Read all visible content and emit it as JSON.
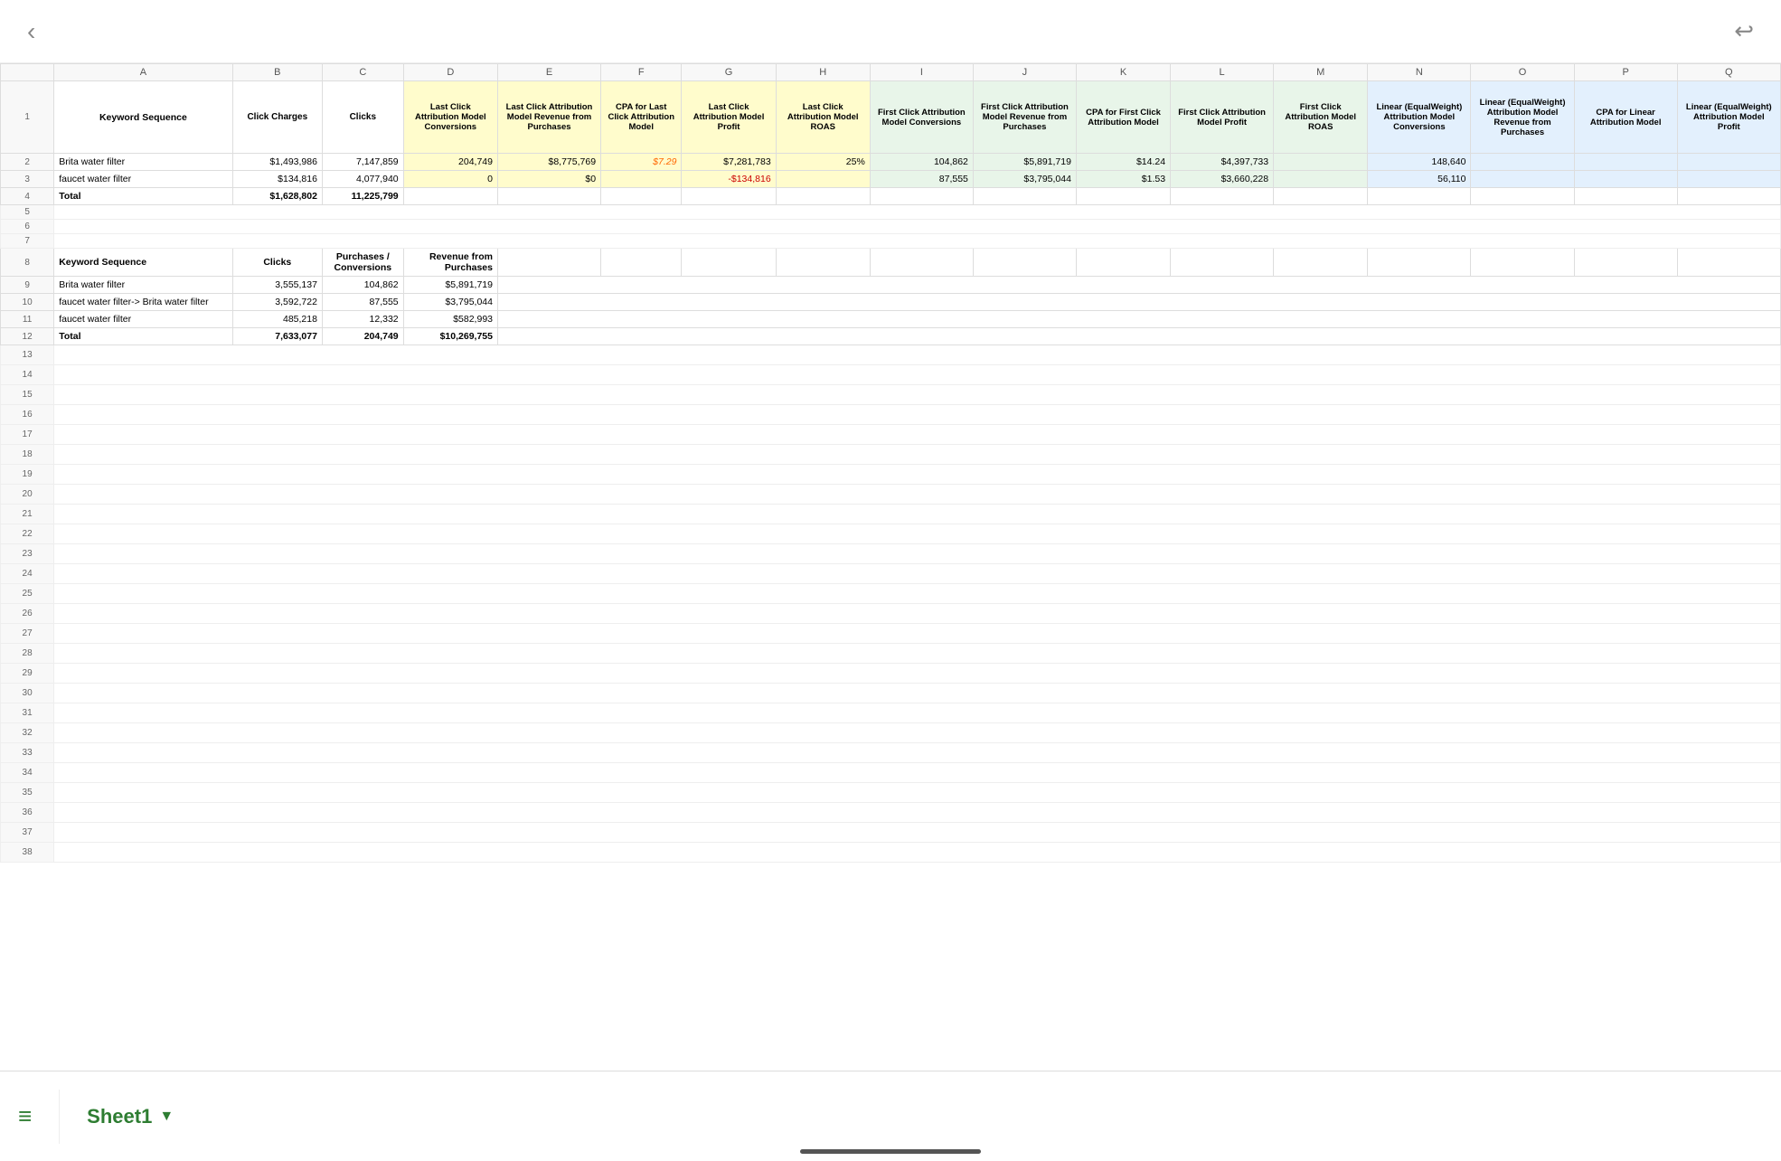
{
  "topBar": {
    "backLabel": "‹",
    "undoLabel": "↩"
  },
  "columns": {
    "letters": [
      "A",
      "B",
      "C",
      "D",
      "E",
      "F",
      "G",
      "H",
      "I",
      "J",
      "K",
      "L",
      "M",
      "N",
      "O",
      "P",
      "Q"
    ]
  },
  "headerRow": {
    "A": "Keyword Sequence",
    "B": "Click Charges",
    "C": "Clicks",
    "D": "Last Click Attribution Model Conversions",
    "E": "Last Click Attribution Model Revenue from Purchases",
    "F": "CPA for Last Click Attribution Model",
    "G": "Last Click Attribution Model Profit",
    "H": "Last Click Attribution Model ROAS",
    "I": "First Click Attribution Model Conversions",
    "J": "First Click Attribution Model Revenue from Purchases",
    "K": "CPA for First Click Attribution Model",
    "L": "First Click Attribution Model Profit",
    "M": "First Click Attribution Model ROAS",
    "N": "Linear (EqualWeight) Attribution Model Conversions",
    "O": "Linear (EqualWeight) Attribution Model Revenue from Purchases",
    "P": "CPA for Linear Attribution Model",
    "Q": "Linear (EqualWeight) Attribution Model Profit"
  },
  "dataRows": [
    {
      "rowNum": 2,
      "A": "Brita water filter",
      "B": "$1,493,986",
      "C": "7,147,859",
      "D": "204,749",
      "E": "$8,775,769",
      "F": "$7.29",
      "G": "$7,281,783",
      "H": "25%",
      "I": "104,862",
      "J": "$5,891,719",
      "K": "$14.24",
      "L": "$4,397,733",
      "M": "",
      "N": "148,640",
      "O": "",
      "P": "",
      "Q": ""
    },
    {
      "rowNum": 3,
      "A": "faucet water filter",
      "B": "$134,816",
      "C": "4,077,940",
      "D": "0",
      "E": "$0",
      "F": "",
      "G": "-$134,816",
      "H": "",
      "I": "87,555",
      "J": "$3,795,044",
      "K": "$1.53",
      "L": "$3,660,228",
      "M": "",
      "N": "56,110",
      "O": "",
      "P": "",
      "Q": ""
    },
    {
      "rowNum": 4,
      "A": "Total",
      "B": "$1,628,802",
      "C": "11,225,799",
      "D": "",
      "E": "",
      "F": "",
      "G": "",
      "H": "",
      "I": "",
      "J": "",
      "K": "",
      "L": "",
      "M": "",
      "N": "",
      "O": "",
      "P": "",
      "Q": ""
    },
    {
      "rowNum": 5,
      "A": "",
      "B": "",
      "C": "",
      "D": "",
      "E": "",
      "F": "",
      "G": "",
      "H": "",
      "I": "",
      "J": "",
      "K": "",
      "L": "",
      "M": "",
      "N": "",
      "O": "",
      "P": "",
      "Q": ""
    },
    {
      "rowNum": 6,
      "A": "",
      "B": "",
      "C": "",
      "D": "",
      "E": "",
      "F": "",
      "G": "",
      "H": "",
      "I": "",
      "J": "",
      "K": "",
      "L": "",
      "M": "",
      "N": "",
      "O": "",
      "P": "",
      "Q": ""
    },
    {
      "rowNum": 7,
      "A": "",
      "B": "",
      "C": "",
      "D": "",
      "E": "",
      "F": "",
      "G": "",
      "H": "",
      "I": "",
      "J": "",
      "K": "",
      "L": "",
      "M": "",
      "N": "",
      "O": "",
      "P": "",
      "Q": ""
    }
  ],
  "secondHeaderRow": {
    "rowNum": 8,
    "A": "Keyword Sequence",
    "B": "Clicks",
    "C": "Purchases / Conversions",
    "D": "Revenue from Purchases",
    "E": "",
    "F": "",
    "G": "",
    "H": "",
    "I": "",
    "J": "",
    "K": "",
    "L": "",
    "M": "",
    "N": "",
    "O": "",
    "P": "",
    "Q": ""
  },
  "secondDataRows": [
    {
      "rowNum": 9,
      "A": "Brita water filter",
      "B": "3,555,137",
      "C": "104,862",
      "D": "$5,891,719",
      "E": "",
      "F": "",
      "G": "",
      "H": "",
      "I": "",
      "J": "",
      "K": "",
      "L": "",
      "M": "",
      "N": "",
      "O": "",
      "P": "",
      "Q": ""
    },
    {
      "rowNum": 10,
      "A": "faucet water filter-> Brita water filter",
      "B": "3,592,722",
      "C": "87,555",
      "D": "$3,795,044",
      "E": "",
      "F": "",
      "G": "",
      "H": "",
      "I": "",
      "J": "",
      "K": "",
      "L": "",
      "M": "",
      "N": "",
      "O": "",
      "P": "",
      "Q": ""
    },
    {
      "rowNum": 11,
      "A": "faucet water filter",
      "B": "485,218",
      "C": "12,332",
      "D": "$582,993",
      "E": "",
      "F": "",
      "G": "",
      "H": "",
      "I": "",
      "J": "",
      "K": "",
      "L": "",
      "M": "",
      "N": "",
      "O": "",
      "P": "",
      "Q": ""
    },
    {
      "rowNum": 12,
      "A": "Total",
      "B": "7,633,077",
      "C": "204,749",
      "D": "$10,269,755",
      "E": "",
      "F": "",
      "G": "",
      "H": "",
      "I": "",
      "J": "",
      "K": "",
      "L": "",
      "M": "",
      "N": "",
      "O": "",
      "P": "",
      "Q": ""
    }
  ],
  "emptyRows": [
    13,
    14,
    15,
    16,
    17,
    18,
    19,
    20,
    21,
    22,
    23,
    24,
    25,
    26,
    27,
    28,
    29,
    30,
    31,
    32,
    33,
    34,
    35,
    36,
    37,
    38
  ],
  "bottomBar": {
    "menuIcon": "≡",
    "sheetName": "Sheet1",
    "arrowIcon": "▼"
  }
}
